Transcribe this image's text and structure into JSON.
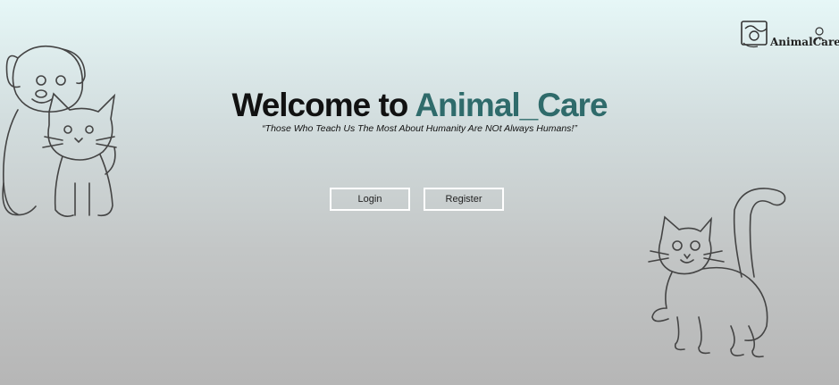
{
  "header": {
    "logo_text": "AnimalCare"
  },
  "hero": {
    "title_prefix": "Welcome to ",
    "title_accent": "Animal_Care",
    "tagline": "“Those Who Teach Us The Most About Humanity Are NOt Always Humans!”"
  },
  "actions": {
    "login_label": "Login",
    "register_label": "Register"
  },
  "colors": {
    "accent": "#2f6b6b",
    "title": "#111111",
    "button_border": "#ffffff"
  },
  "icons": [
    "dog-and-kitten-illustration",
    "cat-illustration",
    "animal-care-logo"
  ]
}
